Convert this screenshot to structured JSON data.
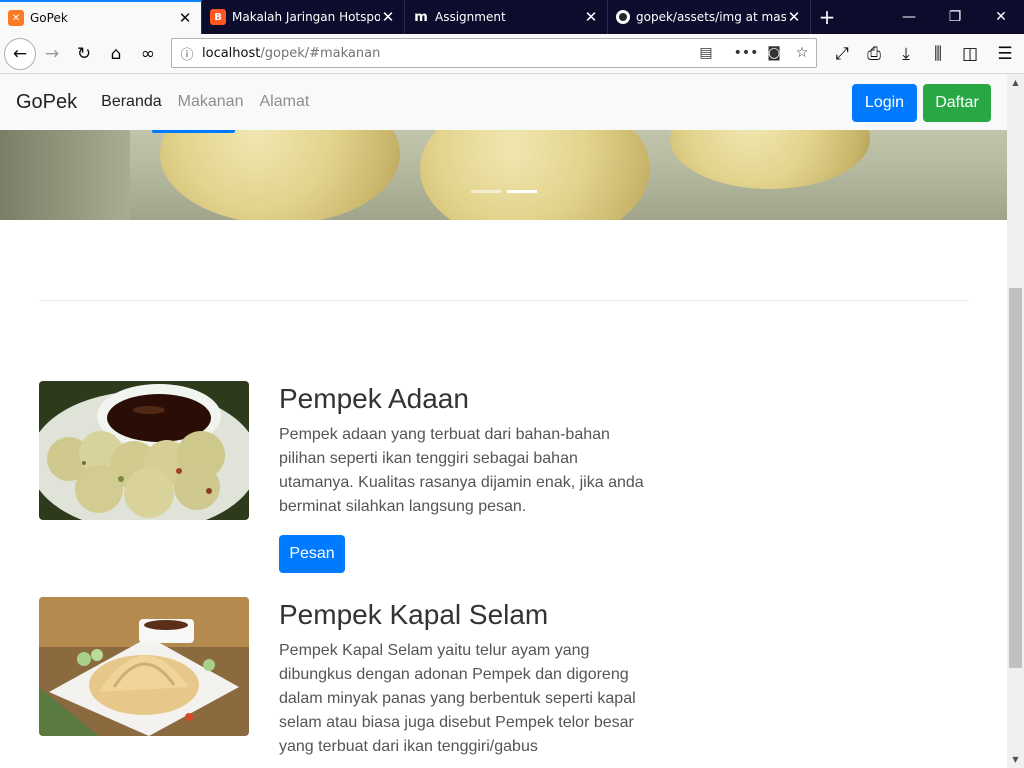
{
  "browser": {
    "tabs": [
      {
        "title": "GoPek",
        "favicon": "xampp-icon",
        "color": "#fb7a24",
        "active": true
      },
      {
        "title": "Makalah Jaringan Hotspot",
        "favicon": "blogger-icon",
        "color": "#ff5722",
        "active": false
      },
      {
        "title": "Assignment",
        "favicon": "moodle-icon",
        "color": "#f98012",
        "active": false
      },
      {
        "title": "gopek/assets/img at maste",
        "favicon": "github-icon",
        "color": "#24292e",
        "active": false
      }
    ],
    "url_host": "localhost",
    "url_path": "/gopek/#makanan"
  },
  "site": {
    "brand": "GoPek",
    "nav": [
      "Beranda",
      "Makanan",
      "Alamat"
    ],
    "login": "Login",
    "daftar": "Daftar"
  },
  "menu": [
    {
      "title": "Pempek Adaan",
      "description": "Pempek adaan yang terbuat dari bahan-bahan pilihan seperti ikan tenggiri sebagai bahan utamanya. Kualitas rasanya dijamin enak, jika anda berminat silahkan langsung pesan.",
      "button": "Pesan"
    },
    {
      "title": "Pempek Kapal Selam",
      "description": "Pempek Kapal Selam yaitu telur ayam yang dibungkus dengan adonan Pempek dan digoreng dalam minyak panas yang berbentuk seperti kapal selam atau biasa juga disebut Pempek telor besar yang terbuat dari ikan tenggiri/gabus"
    }
  ],
  "colors": {
    "primary": "#007bff",
    "success": "#28a745",
    "tab_accent": "#0a84ff"
  }
}
